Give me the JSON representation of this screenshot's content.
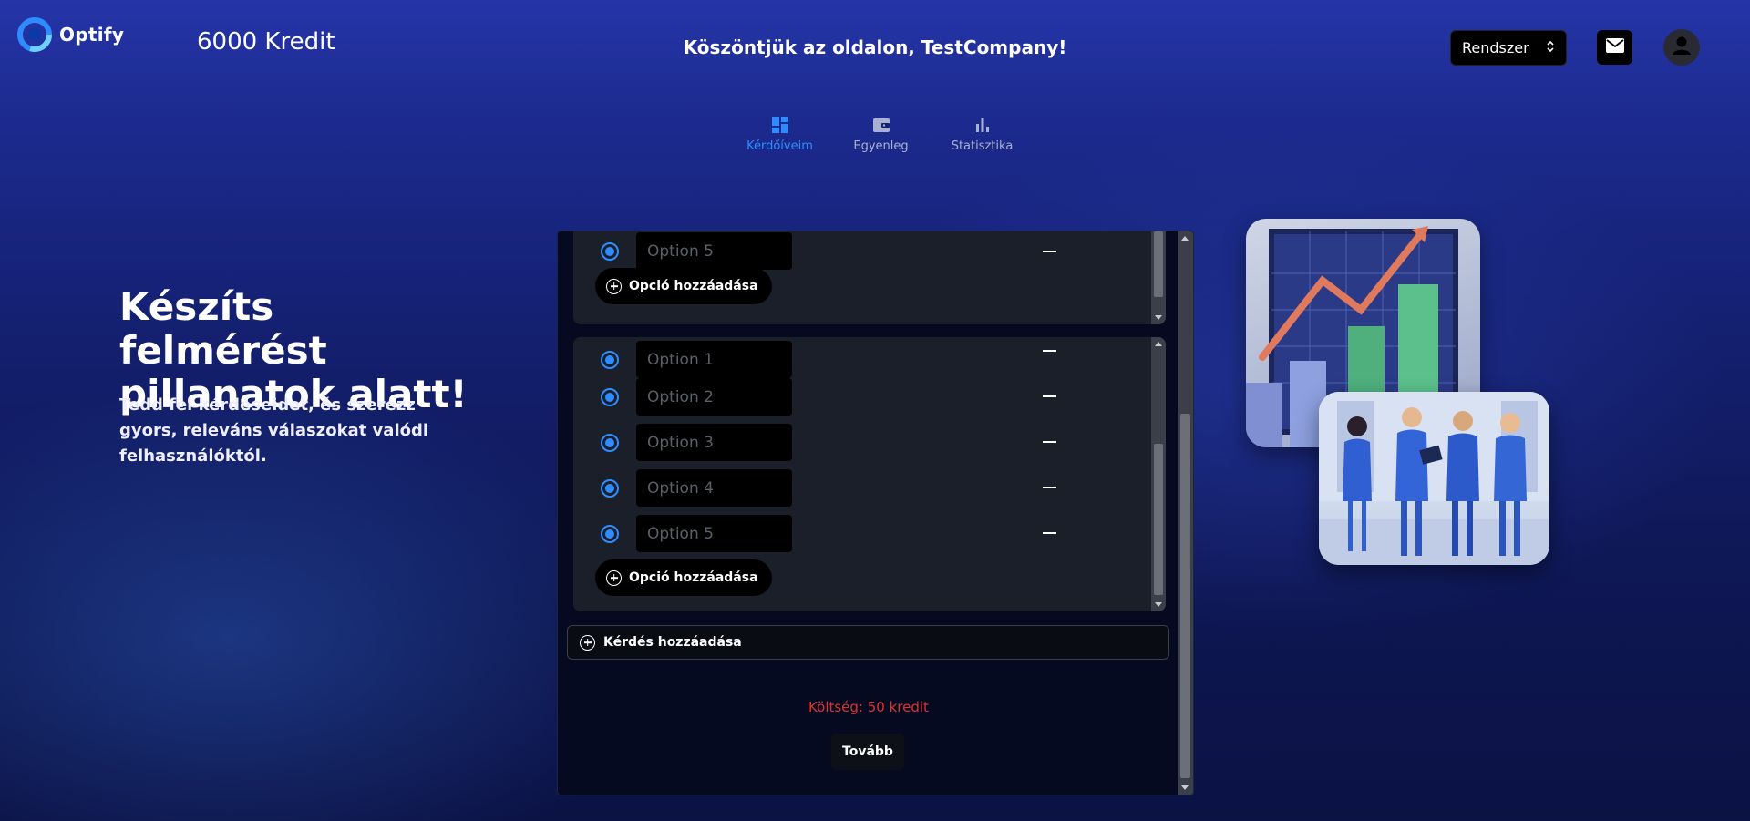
{
  "header": {
    "logo_text": "Optify",
    "credit": "6000 Kredit",
    "welcome": "Köszöntjük az oldalon, TestCompany!",
    "system_select": "Rendszer"
  },
  "nav": {
    "items": [
      {
        "label": "Kérdőíveim",
        "icon": "dashboard-icon",
        "active": true
      },
      {
        "label": "Egyenleg",
        "icon": "wallet-icon",
        "active": false
      },
      {
        "label": "Statisztika",
        "icon": "bar-chart-icon",
        "active": false
      }
    ]
  },
  "hero": {
    "title": "Készíts felmérést pillanatok alatt!",
    "subtitle": "Tedd fel kérdéseidet, és szerezz gyors, releváns válaszokat valódi felhasználóktól."
  },
  "form": {
    "question1": {
      "options": [
        {
          "placeholder": "Option 5"
        }
      ],
      "add_option_label": "Opció hozzáadása"
    },
    "question2": {
      "options": [
        {
          "placeholder": "Option 1"
        },
        {
          "placeholder": "Option 2"
        },
        {
          "placeholder": "Option 3"
        },
        {
          "placeholder": "Option 4"
        },
        {
          "placeholder": "Option 5"
        }
      ],
      "add_option_label": "Opció hozzáadása"
    },
    "add_question_label": "Kérdés hozzáadása",
    "cost": "Költség: 50 kredit",
    "next_label": "Tovább"
  },
  "colors": {
    "accent": "#2f8cff",
    "cost_red": "#e03030"
  }
}
